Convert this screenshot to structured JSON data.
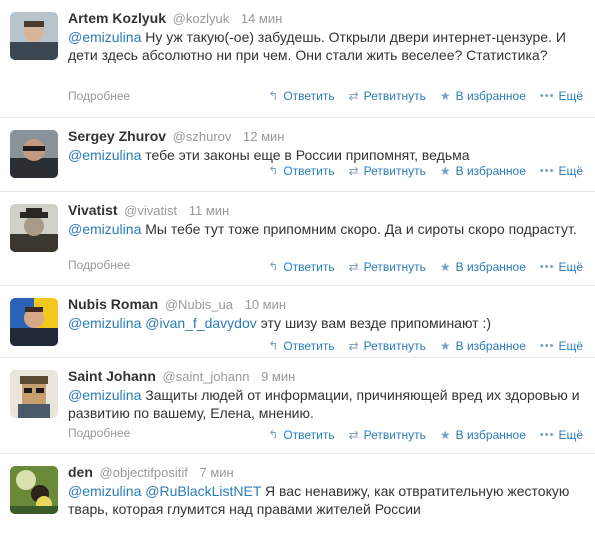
{
  "actions": {
    "reply": "Ответить",
    "retweet": "Ретвитнуть",
    "favorite": "В избранное",
    "more": "Ещё",
    "details": "Подробнее"
  },
  "tweets": [
    {
      "fullname": "Artem Kozlyuk",
      "username": "@kozlyuk",
      "time": "14 мин",
      "mention1": "@emizulina",
      "mention2": "",
      "text": " Ну уж такую(-ое) забудешь. Открыли двери интернет-цензуре. И дети здесь абсолютно ни при чем. Они стали жить веселее? Статистика?"
    },
    {
      "fullname": "Sergey Zhurov",
      "username": "@szhurov",
      "time": "12 мин",
      "mention1": "@emizulina",
      "mention2": "",
      "text": " тебе эти законы еще в России припомнят, ведьма"
    },
    {
      "fullname": "Vivatist",
      "username": "@vivatist",
      "time": "11 мин",
      "mention1": "@emizulina",
      "mention2": "",
      "text": " Мы тебе тут тоже припомним скоро. Да и сироты скоро подрастут."
    },
    {
      "fullname": "Nubis Roman",
      "username": "@Nubis_ua",
      "time": "10 мин",
      "mention1": "@emizulina",
      "mention2": "@ivan_f_davydov",
      "text": " эту шизу вам везде припоминают :)"
    },
    {
      "fullname": "Saint Johann",
      "username": "@saint_johann",
      "time": "9 мин",
      "mention1": "@emizulina",
      "mention2": "",
      "text": " Защиты людей от информации, причиняющей вред их здоровью и развитию по вашему, Елена, мнению."
    },
    {
      "fullname": "den",
      "username": "@objectifpositif",
      "time": "7 мин",
      "mention1": "@emizulina",
      "mention2": "@RuBlackListNET",
      "text": " Я вас ненавижу, как отвратительную жестокую тварь, которая глумится над правами жителей России"
    }
  ]
}
